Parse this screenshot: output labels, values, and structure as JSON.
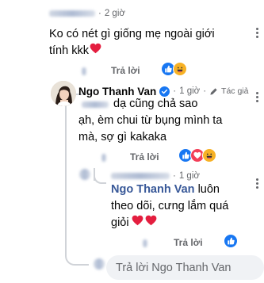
{
  "comment1": {
    "time": "2 giờ",
    "text_line1": "Ko có nét gì giống mẹ ngoài giới",
    "text_line2": "tính kkk",
    "reply_label": "Trả lời"
  },
  "reply1": {
    "author": "Ngo Thanh Van",
    "time": "1 giờ",
    "author_tag": "Tác giả",
    "text_line1": "dạ cũng chả sao",
    "text_line2": "ạh, èm chui từ bụng mình ta",
    "text_line3": "mà, sợ gì kakaka",
    "reply_label": "Trả lời"
  },
  "reply2": {
    "time": "1 giờ",
    "mention": "Ngo Thanh Van",
    "text_after_mention": "luôn",
    "text_line2": "theo dõi, cưng lắm quá",
    "text_line3": "giỏi",
    "reply_label": "Trả lời"
  },
  "reply_input": {
    "placeholder": "Trả lời Ngo Thanh Van"
  },
  "colors": {
    "like_blue": "#1877f2",
    "heart_red": "#f33e58",
    "haha_yellow": "#f7b125"
  },
  "icons": [
    "more-options-icon",
    "verified-badge-icon",
    "pen-icon",
    "like-reaction-icon",
    "haha-reaction-icon",
    "love-reaction-icon",
    "heart-emoji-icon"
  ]
}
